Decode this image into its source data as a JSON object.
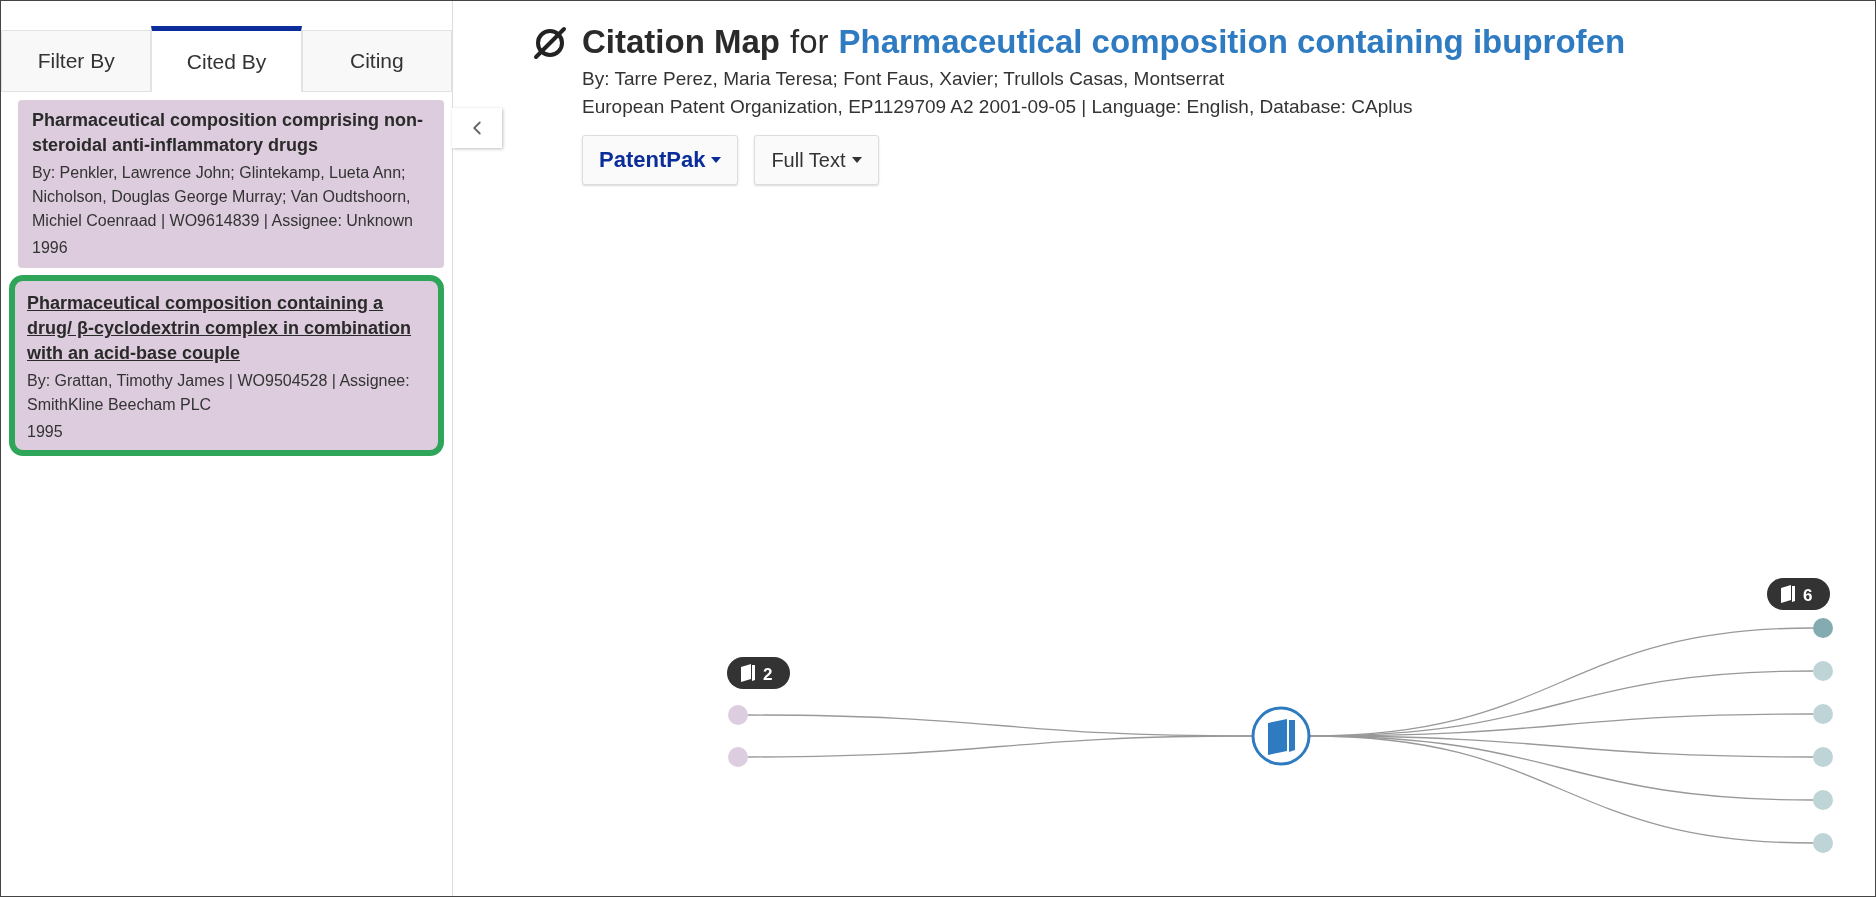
{
  "tabs": [
    {
      "label": "Filter By",
      "selected": false
    },
    {
      "label": "Cited By",
      "selected": true
    },
    {
      "label": "Citing",
      "selected": false
    }
  ],
  "results": [
    {
      "title": "Pharmaceutical composition comprising non-steroidal anti-inflammatory drugs",
      "meta": "By: Penkler, Lawrence John; Glintekamp, Lueta Ann; Nicholson, Douglas George Murray; Van Oudtshoorn, Michiel Coenraad | WO9614839 | Assignee: Unknown",
      "year": "1996",
      "selected": false
    },
    {
      "title": "Pharmaceutical composition containing a drug/ β-cyclodextrin complex in combination with an acid-base couple",
      "meta": "By: Grattan, Timothy James | WO9504528 | Assignee: SmithKline Beecham PLC",
      "year": "1995",
      "selected": true
    }
  ],
  "header": {
    "title": "Citation Map",
    "connector": "for",
    "subject": "Pharmaceutical composition containing ibuprofen",
    "authors": "By: Tarre Perez, Maria Teresa; Font Faus, Xavier; Trullols Casas, Montserrat",
    "source": "European Patent Organization, EP1129709 A2 2001-09-05 | Language: English, Database: CAplus"
  },
  "buttons": [
    {
      "label": "PatentPak",
      "kind": "brand"
    },
    {
      "label": "Full Text",
      "kind": "plain"
    }
  ],
  "map": {
    "cited_by": {
      "count": "2",
      "nodes": [
        {
          "highlighted": false
        },
        {
          "highlighted": false
        }
      ]
    },
    "citing": {
      "count": "6",
      "nodes": [
        {
          "highlighted": true
        },
        {
          "highlighted": false
        },
        {
          "highlighted": false
        },
        {
          "highlighted": false
        },
        {
          "highlighted": false
        },
        {
          "highlighted": false
        }
      ]
    }
  }
}
